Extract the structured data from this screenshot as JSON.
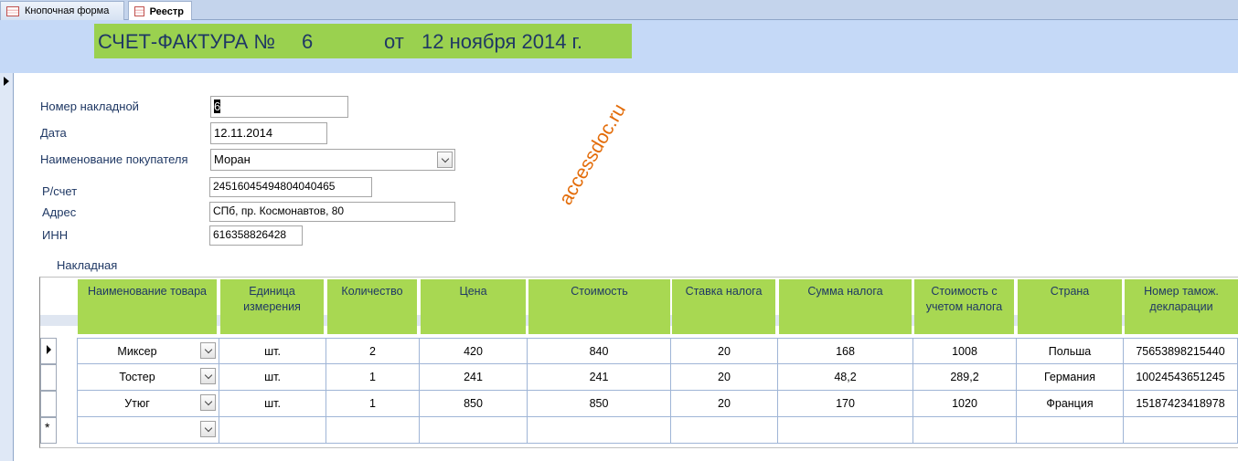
{
  "tabs": [
    {
      "label": "Кнопочная форма"
    },
    {
      "label": "Реестр"
    }
  ],
  "header": {
    "title_left": "СЧЕТ-ФАКТУРА №",
    "invoice_number": "6",
    "title_from": "от",
    "date_text": "12 ноября 2014 г."
  },
  "form": {
    "invoice_no_label": "Номер накладной",
    "invoice_no_value": "6",
    "date_label": "Дата",
    "date_value": "12.11.2014",
    "buyer_label": "Наименование покупателя",
    "buyer_value": "Моран",
    "account_label": "Р/счет",
    "account_value": "24516045494804040465",
    "address_label": "Адрес",
    "address_value": "СПб, пр. Космонавтов, 80",
    "inn_label": "ИНН",
    "inn_value": "616358826428"
  },
  "watermark": "accessdoc.ru",
  "subform": {
    "label": "Накладная",
    "columns": [
      "Наименование товара",
      "Единица измерения",
      "Количество",
      "Цена",
      "Стоимость",
      "Ставка налога",
      "Сумма налога",
      "Стоимость с учетом налога",
      "Страна",
      "Номер тамож. декларации"
    ],
    "rows": [
      [
        "Миксер",
        "шт.",
        "2",
        "420",
        "840",
        "20",
        "168",
        "1008",
        "Польша",
        "75653898215440"
      ],
      [
        "Тостер",
        "шт.",
        "1",
        "241",
        "241",
        "20",
        "48,2",
        "289,2",
        "Германия",
        "10024543651245"
      ],
      [
        "Утюг",
        "шт.",
        "1",
        "850",
        "850",
        "20",
        "170",
        "1020",
        "Франция",
        "15187423418978"
      ]
    ],
    "new_row_marker": "*"
  }
}
